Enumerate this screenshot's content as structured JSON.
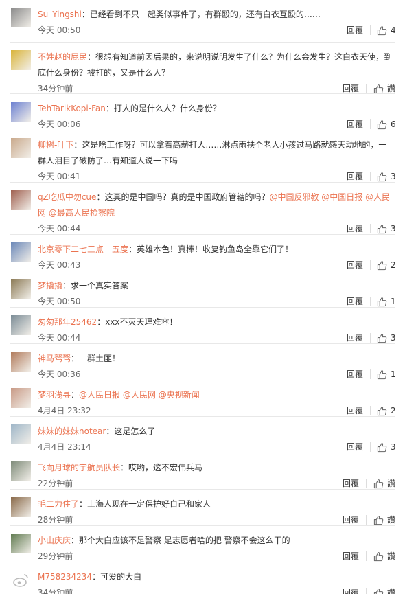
{
  "comments": [
    {
      "user": "Su_Yingshi",
      "segments": [
        {
          "t": "：已经看到不只一起类似事件了，有群殴的，还有白衣互殴的……",
          "m": false
        }
      ],
      "time": "今天 00:50",
      "reply": "回覆",
      "likes": "4",
      "avatar_color": "#8a8a8a"
    },
    {
      "user": "不姓赵的屁民",
      "segments": [
        {
          "t": "：很想有知道前因后果的，来说明说明发生了什么？为什么会发生？这白衣天使，到底什么身份？被打的，又是什么人？",
          "m": false
        }
      ],
      "time": "34分钟前",
      "reply": "回覆",
      "likes": "讚",
      "avatar_color": "#d9b43a"
    },
    {
      "user": "TehTarikKopi-Fan",
      "segments": [
        {
          "t": "：打人的是什么人？什么身份？",
          "m": false
        }
      ],
      "time": "今天 00:06",
      "reply": "回覆",
      "likes": "6",
      "avatar_color": "#6a7fd1"
    },
    {
      "user": "柳树-叶下",
      "segments": [
        {
          "t": "：这是啥工作呀？可以拿着高薪打人……淋点雨扶个老人小孩过马路就感天动地的，一群人泪目了破防了…有知道人说一下吗",
          "m": false
        }
      ],
      "time": "今天 00:41",
      "reply": "回覆",
      "likes": "3",
      "avatar_color": "#c9a98c"
    },
    {
      "user": "qZ吃瓜中勿cue",
      "segments": [
        {
          "t": "：这真的是中国吗？真的是中国政府管辖的吗？",
          "m": false
        },
        {
          "t": "@中国反邪教",
          "m": true
        },
        {
          "t": " ",
          "m": false
        },
        {
          "t": "@中国日报",
          "m": true
        },
        {
          "t": " ",
          "m": false
        },
        {
          "t": "@人民网",
          "m": true
        },
        {
          "t": " ",
          "m": false
        },
        {
          "t": "@最高人民检察院",
          "m": true
        }
      ],
      "time": "今天 00:44",
      "reply": "回覆",
      "likes": "3",
      "avatar_color": "#a06050"
    },
    {
      "user": "北京零下二七三点一五度",
      "segments": [
        {
          "t": "：英雄本色！真棒！收复钓鱼岛全靠它们了！",
          "m": false
        }
      ],
      "time": "今天 00:43",
      "reply": "回覆",
      "likes": "2",
      "avatar_color": "#6b88b8"
    },
    {
      "user": "梦撬撬",
      "segments": [
        {
          "t": "：求一个真实答案",
          "m": false
        }
      ],
      "time": "今天 00:50",
      "reply": "回覆",
      "likes": "1",
      "avatar_color": "#8b7a55"
    },
    {
      "user": "匆匆那年25462",
      "segments": [
        {
          "t": "：xxx不灭天理难容！",
          "m": false
        }
      ],
      "time": "今天 00:44",
      "reply": "回覆",
      "likes": "3",
      "avatar_color": "#7b8c96"
    },
    {
      "user": "神马驽驽",
      "segments": [
        {
          "t": "：一群土匪！",
          "m": false
        }
      ],
      "time": "今天 00:36",
      "reply": "回覆",
      "likes": "1",
      "avatar_color": "#b07a5a"
    },
    {
      "user": "梦羽浅寻",
      "segments": [
        {
          "t": "：",
          "m": false
        },
        {
          "t": "@人民日报",
          "m": true
        },
        {
          "t": " ",
          "m": false
        },
        {
          "t": "@人民网",
          "m": true
        },
        {
          "t": " ",
          "m": false
        },
        {
          "t": "@央视新闻",
          "m": true
        }
      ],
      "time": "4月4日 23:32",
      "reply": "回覆",
      "likes": "2",
      "avatar_color": "#c89a86"
    },
    {
      "user": "妹妹的妹妹notear",
      "segments": [
        {
          "t": "：这是怎么了",
          "m": false
        }
      ],
      "time": "4月4日 23:14",
      "reply": "回覆",
      "likes": "3",
      "avatar_color": "#9fb6c8"
    },
    {
      "user": "飞向月球的宇航员队长",
      "segments": [
        {
          "t": "：哎哟，这不宏伟兵马",
          "m": false
        }
      ],
      "time": "22分钟前",
      "reply": "回覆",
      "likes": "讚",
      "avatar_color": "#7d8a78"
    },
    {
      "user": "毛二力住了",
      "segments": [
        {
          "t": "：上海人现在一定保护好自己和家人",
          "m": false
        }
      ],
      "time": "28分钟前",
      "reply": "回覆",
      "likes": "讚",
      "avatar_color": "#8a6a4a"
    },
    {
      "user": "小山庆庆",
      "segments": [
        {
          "t": "：那个大白应该不是警察 是志愿者啥的把 警察不会这么干的",
          "m": false
        }
      ],
      "time": "29分钟前",
      "reply": "回覆",
      "likes": "讚",
      "avatar_color": "#5f7a4f"
    },
    {
      "user": "M758234234",
      "segments": [
        {
          "t": "：可爱的大白",
          "m": false
        }
      ],
      "time": "34分钟前",
      "reply": "回覆",
      "likes": "讚",
      "avatar_color": "#dddddd",
      "avatar_icon": "weibo-default-icon"
    }
  ]
}
